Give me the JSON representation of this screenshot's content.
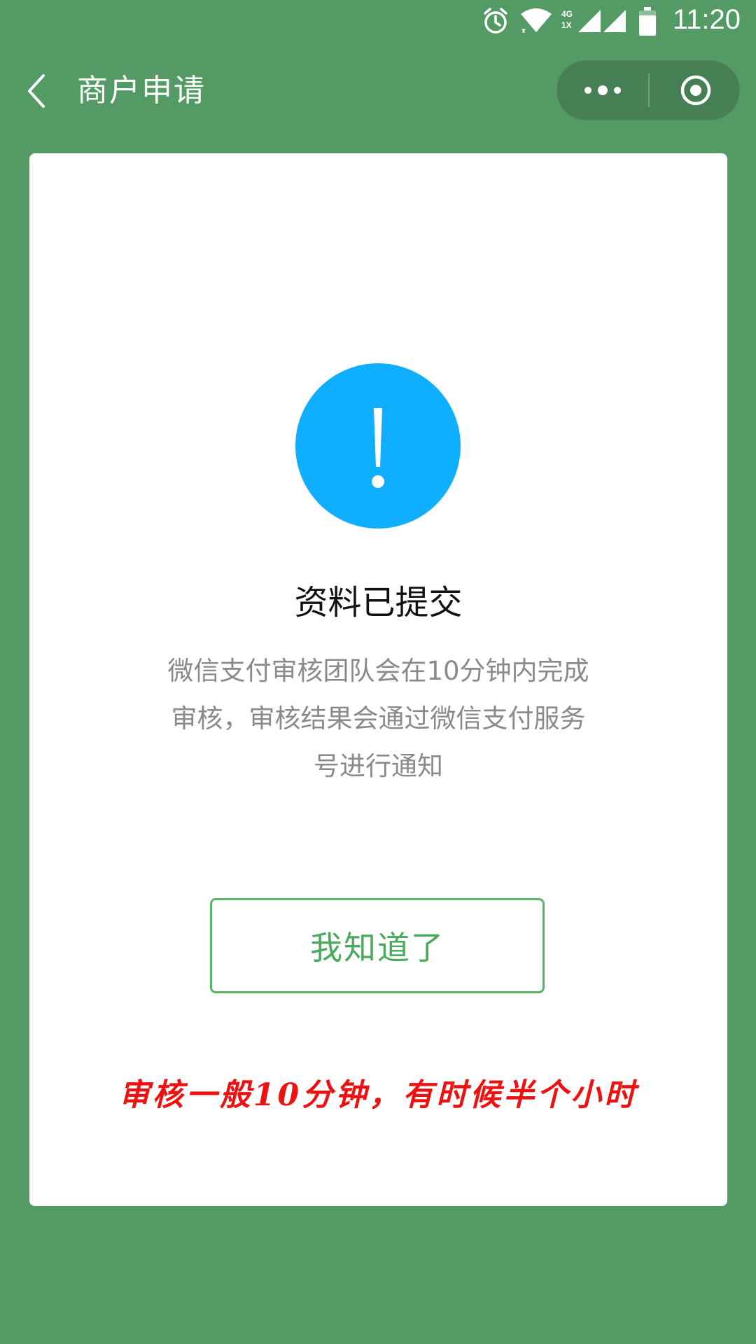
{
  "status_bar": {
    "time": "11:20",
    "network_label_top": "4G",
    "network_label_bottom": "1X",
    "icons": [
      "alarm-icon",
      "wifi-icon",
      "signal-4g-icon",
      "signal-icon",
      "battery-icon"
    ]
  },
  "nav": {
    "back_icon": "chevron-left-icon",
    "title": "商户申请",
    "more_icon": "more-dots-icon",
    "close_icon": "target-circle-icon"
  },
  "card": {
    "icon": "exclamation-circle-icon",
    "title": "资料已提交",
    "description_lines": [
      "微信支付审核团队会在10分钟内完成",
      "审核，审核结果会通过微信支付服务",
      "号进行通知"
    ],
    "button_label": "我知道了",
    "note": "审核一般10分钟，有时候半个小时"
  },
  "colors": {
    "background": "#539a65",
    "capsule": "#467f54",
    "card": "#ffffff",
    "alert_icon": "#10aeff",
    "button_border": "#57b568",
    "button_text": "#4aa95c",
    "note": "#ee1111",
    "description": "#8a8a8a"
  }
}
